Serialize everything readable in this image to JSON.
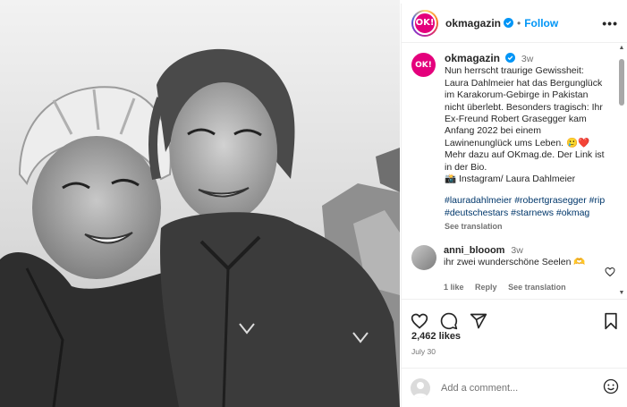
{
  "post": {
    "username": "okmagazin",
    "avatar_text": "OK!",
    "follow_label": "Follow",
    "dot": "•",
    "more": "•••"
  },
  "caption": {
    "username": "okmagazin",
    "time": "3w",
    "text": "Nun herrscht traurige Gewissheit: Laura Dahlmeier hat das Bergunglück im Karakorum-Gebirge in Pakistan nicht überlebt. Besonders tragisch: Ihr Ex-Freund Robert Grasegger kam Anfang 2022 bei einem Lawinenunglück ums Leben. 🥲❤️ Mehr dazu auf OKmag.de. Der Link ist in der Bio.",
    "credit": "📸 Instagram/ Laura Dahlmeier",
    "hashtags": "#lauradahlmeier #robertgrasegger #rip #deutschestars #starnews #okmag",
    "see_translation": "See translation"
  },
  "comment": {
    "username": "anni_blooom",
    "time": "3w",
    "text": "ihr zwei wunderschöne Seelen 🫶",
    "likes": "1 like",
    "reply": "Reply",
    "see_translation": "See translation"
  },
  "likes_count": "2,462 likes",
  "date": "July 30",
  "add_comment_placeholder": "Add a comment...",
  "icons": [
    "heart-icon",
    "comment-icon",
    "share-icon",
    "bookmark-icon",
    "emoji-icon",
    "verified-icon"
  ],
  "colors": {
    "accent": "#0095f6",
    "brand": "#e4007c",
    "hashtag": "#00376b",
    "muted": "#737373"
  }
}
